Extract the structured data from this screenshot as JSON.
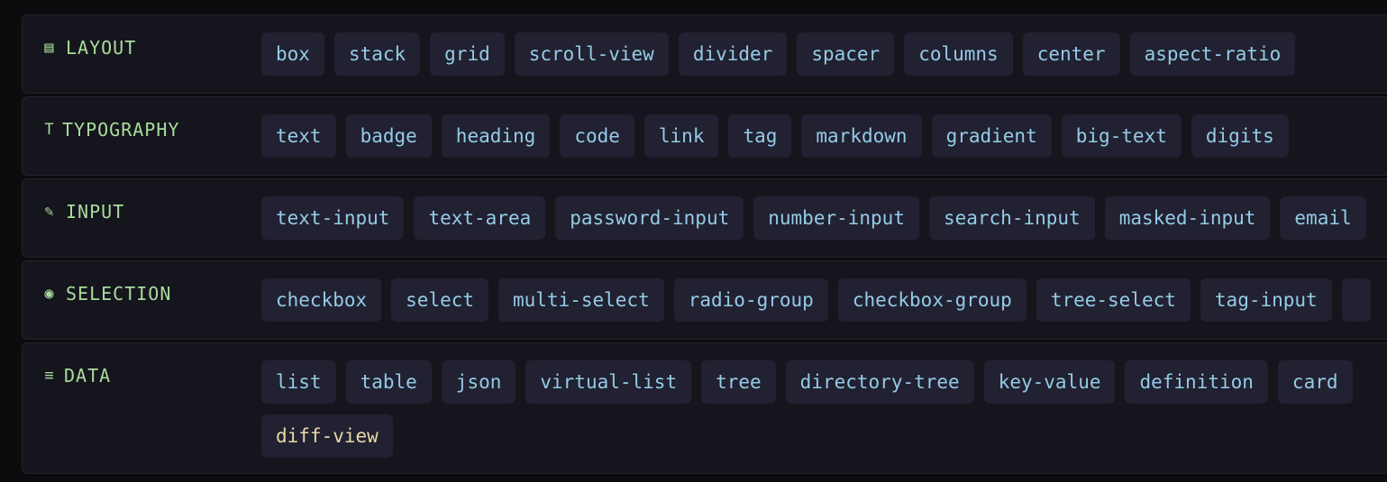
{
  "categories": [
    {
      "id": "layout",
      "icon": "▤",
      "icon_name": "layout-icon",
      "label": "LAYOUT",
      "items": [
        "box",
        "stack",
        "grid",
        "scroll-view",
        "divider",
        "spacer",
        "columns",
        "center",
        "aspect-ratio"
      ]
    },
    {
      "id": "typography",
      "icon": "T",
      "icon_name": "typography-icon",
      "label": "TYPOGRAPHY",
      "items": [
        "text",
        "badge",
        "heading",
        "code",
        "link",
        "tag",
        "markdown",
        "gradient",
        "big-text",
        "digits"
      ]
    },
    {
      "id": "input",
      "icon": "✎",
      "icon_name": "pencil-icon",
      "label": "INPUT",
      "items": [
        "text-input",
        "text-area",
        "password-input",
        "number-input",
        "search-input",
        "masked-input",
        "email"
      ]
    },
    {
      "id": "selection",
      "icon": "◉",
      "icon_name": "radio-icon",
      "label": "SELECTION",
      "items": [
        "checkbox",
        "select",
        "multi-select",
        "radio-group",
        "checkbox-group",
        "tree-select",
        "tag-input",
        ""
      ]
    },
    {
      "id": "data",
      "icon": "≡",
      "icon_name": "list-icon",
      "label": "DATA",
      "items": [
        "list",
        "table",
        "json",
        "virtual-list",
        "tree",
        "directory-tree",
        "key-value",
        "definition",
        "card",
        "diff-view"
      ],
      "highlighted": "diff-view"
    }
  ],
  "colors": {
    "background": "#0c0c0e",
    "row_background": "#15151d",
    "chip_background": "#212132",
    "category_label": "#a9dc9c",
    "chip_text": "#95cbe6",
    "chip_highlight_text": "#ead8a5"
  }
}
